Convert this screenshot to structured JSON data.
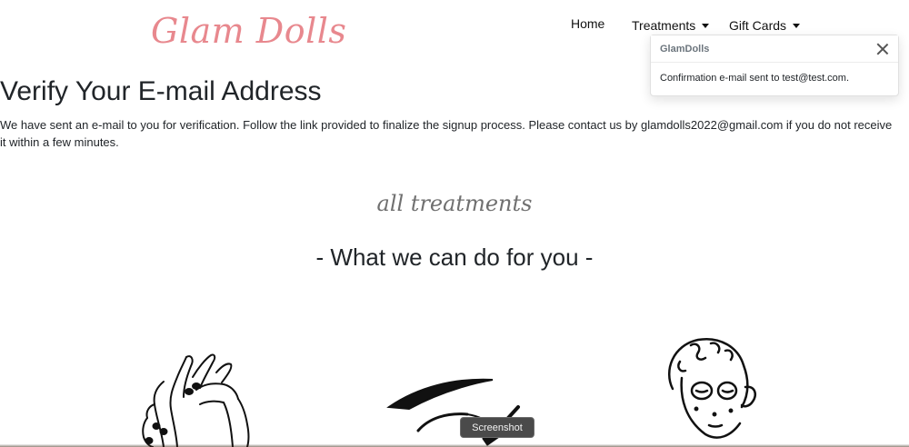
{
  "header": {
    "logo_text": "Glam Dolls",
    "nav": {
      "home": "Home",
      "treatments": "Treatments",
      "gift_cards": "Gift Cards"
    }
  },
  "toast": {
    "title": "GlamDolls",
    "message": "Confirmation e-mail sent to test@test.com."
  },
  "main": {
    "heading": "Verify Your E-mail Address",
    "intro": "We have sent an e-mail to you for verification. Follow the link provided to finalize the signup process. Please contact us by glamdolls2022@gmail.com if you do not receive it within a few minutes.",
    "treatments_script": "all treatments",
    "treatments_heading": "- What we can do for you -"
  },
  "overlay": {
    "screenshot_label": "Screenshot"
  },
  "icons": {
    "hands": "manicure-hands-icon",
    "eye": "eyelash-brow-icon",
    "face": "facial-mask-icon",
    "caret": "chevron-down-icon",
    "close": "close-icon"
  },
  "colors": {
    "logo": "#e8888e",
    "text": "#212529",
    "muted": "#6c757d"
  }
}
